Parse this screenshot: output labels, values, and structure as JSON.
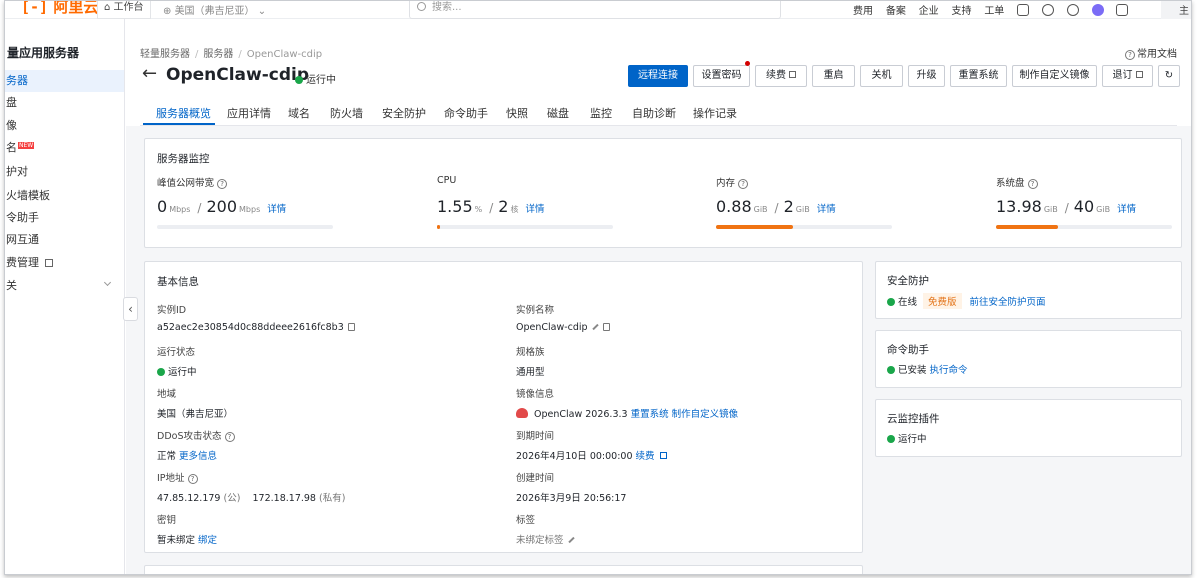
{
  "topbar": {
    "logo": "阿里云",
    "workspace": "工作台",
    "region": "美国（弗吉尼亚）",
    "search_placeholder": "搜索...",
    "links": [
      "费用",
      "备案",
      "企业",
      "支持",
      "工单"
    ],
    "user_tail": "主"
  },
  "sidebar": {
    "title": "量应用服务器",
    "items": [
      {
        "label": "务器",
        "active": true
      },
      {
        "label": "盘",
        "active": false
      },
      {
        "label": "像",
        "active": false
      },
      {
        "label": "名",
        "active": false,
        "badge": "NEW"
      },
      {
        "label": "护对",
        "active": false
      },
      {
        "label": "火墙模板",
        "active": false
      },
      {
        "label": "令助手",
        "active": false
      },
      {
        "label": "网互通",
        "active": false
      },
      {
        "label": "费管理",
        "active": false,
        "external": true
      },
      {
        "label": "关",
        "active": false,
        "expandable": true
      }
    ]
  },
  "header": {
    "breadcrumb": [
      "轻量服务器",
      "服务器",
      "OpenClaw-cdip"
    ],
    "doc_link": "常用文档",
    "title": "OpenClaw-cdip",
    "status": "运行中"
  },
  "toolbar": {
    "remote_connect": "远程连接",
    "set_password": "设置密码",
    "renew": "续费",
    "restart": "重启",
    "shutdown": "关机",
    "upgrade": "升级",
    "reset_system": "重置系统",
    "make_image": "制作自定义镜像",
    "refund": "退订"
  },
  "tabs": [
    "服务器概览",
    "应用详情",
    "域名",
    "防火墙",
    "安全防护",
    "命令助手",
    "快照",
    "磁盘",
    "监控",
    "自助诊断",
    "操作记录"
  ],
  "monitor": {
    "title": "服务器监控",
    "metrics": [
      {
        "label": "峰值公网带宽",
        "value": "0",
        "value_unit": "Mbps",
        "total": "200",
        "total_unit": "Mbps",
        "link": "详情",
        "fraction": 0.0,
        "has_help": true
      },
      {
        "label": "CPU",
        "value": "1.55",
        "value_unit": "%",
        "total": "2",
        "total_unit": "核",
        "link": "详情",
        "fraction": 0.0155,
        "has_help": false
      },
      {
        "label": "内存",
        "value": "0.88",
        "value_unit": "GiB",
        "total": "2",
        "total_unit": "GiB",
        "link": "详情",
        "fraction": 0.44,
        "has_help": true
      },
      {
        "label": "系统盘",
        "value": "13.98",
        "value_unit": "GiB",
        "total": "40",
        "total_unit": "GiB",
        "link": "详情",
        "fraction": 0.35,
        "has_help": true
      }
    ]
  },
  "basic": {
    "title": "基本信息",
    "instance_id_label": "实例ID",
    "instance_id": "a52aec2e30854d0c88ddeee2616fc8b3",
    "instance_name_label": "实例名称",
    "instance_name": "OpenClaw-cdip",
    "run_state_label": "运行状态",
    "run_state": "运行中",
    "spec_family_label": "规格族",
    "spec_family": "通用型",
    "region_label": "地域",
    "region": "美国（弗吉尼亚）",
    "image_label": "镜像信息",
    "image": "OpenClaw 2026.3.3",
    "reset_system": "重置系统",
    "make_image": "制作自定义镜像",
    "ddos_label": "DDoS攻击状态",
    "ddos": "正常",
    "more_info": "更多信息",
    "expire_label": "到期时间",
    "expire": "2026年4月10日 00:00:00",
    "renew": "续费",
    "ip_label": "IP地址",
    "public_ip": "47.85.12.179",
    "public_tag": "(公)",
    "private_ip": "172.18.17.98",
    "private_tag": "(私有)",
    "created_label": "创建时间",
    "created": "2026年3月9日 20:56:17",
    "key_label": "密钥",
    "key": "暂未绑定",
    "bind": "绑定",
    "tags_label": "标签",
    "tags": "未绑定标签"
  },
  "side_cards": {
    "security": {
      "title": "安全防护",
      "status": "在线",
      "badge": "免费版",
      "link": "前往安全防护页面"
    },
    "command": {
      "title": "命令助手",
      "status": "已安装",
      "link": "执行命令"
    },
    "cloud_monitor": {
      "title": "云监控插件",
      "status": "运行中"
    }
  },
  "colors": {
    "primary": "#0064c8",
    "success": "#1aa64a",
    "usage_bar": "#f07312",
    "brand": "#ff6a00"
  }
}
